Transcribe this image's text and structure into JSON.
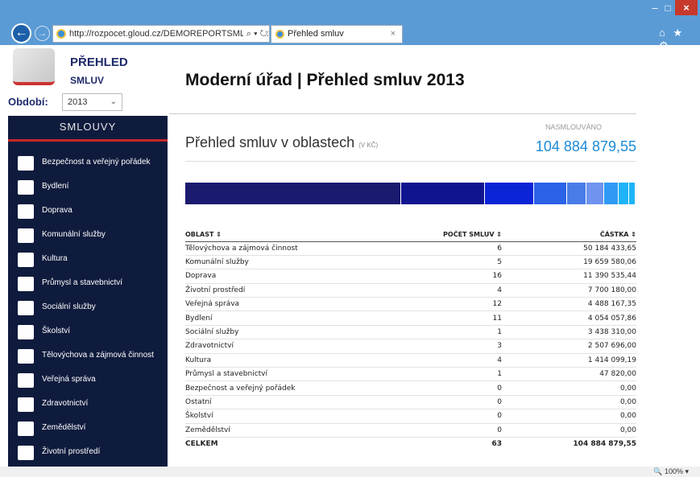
{
  "browser": {
    "url": "http://rozpocet.gloud.cz/DEMOREPORTSML/index.ht",
    "url_tools": "⌕ ▾ ↻",
    "tab_title": "Přehled smluv",
    "tab_close": "×",
    "toolbar_icons": "⌂ ★ ⚙",
    "zoom": "100%",
    "back_glyph": "←",
    "forward_glyph": "→",
    "min_glyph": "–",
    "max_glyph": "□",
    "close_glyph": "×"
  },
  "sidebar": {
    "logo_line1": "PŘEHLED",
    "logo_line2": "SMLUV",
    "period_label": "Období:",
    "period_value": "2013",
    "title": "SMLOUVY",
    "items": [
      {
        "label": "Bezpečnost a veřejný pořádek",
        "icon": "police-icon"
      },
      {
        "label": "Bydlení",
        "icon": "house-icon"
      },
      {
        "label": "Doprava",
        "icon": "traffic-icon"
      },
      {
        "label": "Komunální služby",
        "icon": "waste-icon"
      },
      {
        "label": "Kultura",
        "icon": "mask-icon"
      },
      {
        "label": "Průmysl a stavebnictví",
        "icon": "factory-icon"
      },
      {
        "label": "Sociální služby",
        "icon": "social-icon"
      },
      {
        "label": "Školství",
        "icon": "graduation-cap-icon"
      },
      {
        "label": "Tělovýchova a zájmová činnost",
        "icon": "sport-icon"
      },
      {
        "label": "Veřejná správa",
        "icon": "flags-icon"
      },
      {
        "label": "Zdravotnictví",
        "icon": "health-icon"
      },
      {
        "label": "Zemědělství",
        "icon": "farm-icon"
      },
      {
        "label": "Životní prostředí",
        "icon": "recycle-icon"
      }
    ]
  },
  "main": {
    "title": "Moderní úřad | Přehled smluv 2013",
    "section_title": "Přehled smluv v oblastech",
    "section_unit": "(V KČ)",
    "nasmlouvano_label": "NASMLOUVÁNO",
    "nasmlouvano_value": "104 884 879,55"
  },
  "colors": {
    "sidebar_bg": "#0f1b3d",
    "accent_red": "#c62828",
    "total_blue": "#1c8ad6",
    "bar_segments": [
      "#1a1a6e",
      "#10148f",
      "#0a24d6",
      "#2a62e8",
      "#4a7ce8",
      "#6f93ee",
      "#2f9af5",
      "#1eb4f7"
    ]
  },
  "table": {
    "headers": {
      "oblast": "OBLAST ⇕",
      "pocet": "POČET SMLUV ⇕",
      "castka": "ČÁSTKA ⇕"
    },
    "rows": [
      {
        "oblast": "Tělovýchova a zájmová činnost",
        "pocet": "6",
        "castka": "50 184 433,65"
      },
      {
        "oblast": "Komunální služby",
        "pocet": "5",
        "castka": "19 659 580,06"
      },
      {
        "oblast": "Doprava",
        "pocet": "16",
        "castka": "11 390 535,44"
      },
      {
        "oblast": "Životní prostředí",
        "pocet": "4",
        "castka": "7 700 180,00"
      },
      {
        "oblast": "Veřejná správa",
        "pocet": "12",
        "castka": "4 488 167,35"
      },
      {
        "oblast": "Bydlení",
        "pocet": "11",
        "castka": "4 054 057,86"
      },
      {
        "oblast": "Sociální služby",
        "pocet": "1",
        "castka": "3 438 310,00"
      },
      {
        "oblast": "Zdravotnictví",
        "pocet": "3",
        "castka": "2 507 696,00"
      },
      {
        "oblast": "Kultura",
        "pocet": "4",
        "castka": "1 414 099,19"
      },
      {
        "oblast": "Průmysl a stavebnictví",
        "pocet": "1",
        "castka": "47 820,00"
      },
      {
        "oblast": "Bezpečnost a veřejný pořádek",
        "pocet": "0",
        "castka": "0,00"
      },
      {
        "oblast": "Ostatní",
        "pocet": "0",
        "castka": "0,00"
      },
      {
        "oblast": "Školství",
        "pocet": "0",
        "castka": "0,00"
      },
      {
        "oblast": "Zemědělství",
        "pocet": "0",
        "castka": "0,00"
      }
    ],
    "total": {
      "oblast": "CELKEM",
      "pocet": "63",
      "castka": "104 884 879,55"
    }
  }
}
